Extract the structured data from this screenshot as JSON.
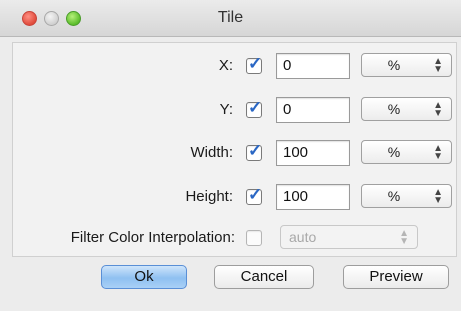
{
  "window": {
    "title": "Tile"
  },
  "fields": {
    "x": {
      "label": "X:",
      "checked": true,
      "value": "0",
      "unit": "%"
    },
    "y": {
      "label": "Y:",
      "checked": true,
      "value": "0",
      "unit": "%"
    },
    "width": {
      "label": "Width:",
      "checked": true,
      "value": "100",
      "unit": "%"
    },
    "height": {
      "label": "Height:",
      "checked": true,
      "value": "100",
      "unit": "%"
    }
  },
  "filter": {
    "label": "Filter Color Interpolation:",
    "checked": false,
    "value": "auto"
  },
  "buttons": {
    "ok": "Ok",
    "cancel": "Cancel",
    "preview": "Preview"
  },
  "glyphs": {
    "check": "✓",
    "arrow_up": "▲",
    "arrow_down": "▼"
  }
}
